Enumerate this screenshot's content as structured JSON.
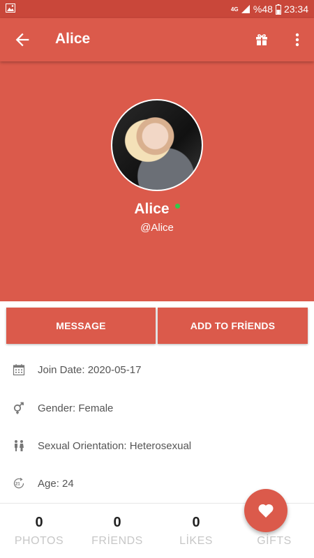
{
  "status_bar": {
    "network": "4G",
    "battery_text": "%48",
    "time": "23:34"
  },
  "app_bar": {
    "title": "Alice"
  },
  "profile": {
    "name": "Alice",
    "handle": "@Alice",
    "online": true
  },
  "actions": {
    "message": "MESSAGE",
    "add_friend": "ADD TO FRİENDS"
  },
  "info": [
    {
      "icon": "calendar-icon",
      "text": "Join Date: 2020-05-17"
    },
    {
      "icon": "gender-icon",
      "text": "Gender: Female"
    },
    {
      "icon": "people-icon",
      "text": "Sexual Orientation: Heterosexual"
    },
    {
      "icon": "age-21-icon",
      "text": "Age: 24"
    }
  ],
  "stats": [
    {
      "count": "0",
      "label": "PHOTOS"
    },
    {
      "count": "0",
      "label": "FRİENDS"
    },
    {
      "count": "0",
      "label": "LİKES"
    },
    {
      "count": "",
      "label": "GİFTS"
    }
  ],
  "colors": {
    "primary": "#db5a4b",
    "status_bar": "#c9473a",
    "online": "#31c94a"
  }
}
